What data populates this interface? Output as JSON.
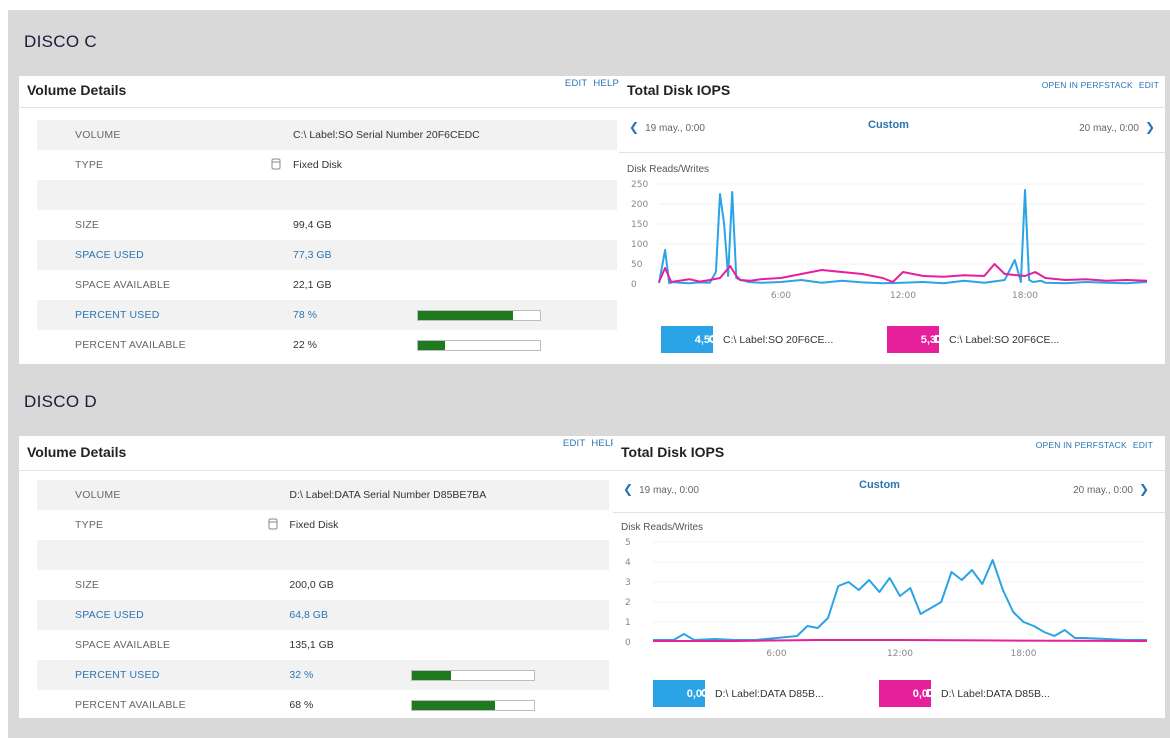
{
  "colors": {
    "reads": "#2aa4e6",
    "writes": "#e6209b",
    "bar": "#1f7a1f",
    "link": "#2b73b3"
  },
  "disks": [
    {
      "section_title": "DISCO C",
      "volume_details": {
        "title": "Volume Details",
        "links": [
          "EDIT",
          "HELP"
        ],
        "rows": [
          {
            "label": "VOLUME",
            "value": "C:\\ Label:SO Serial Number 20F6CEDC"
          },
          {
            "label": "TYPE",
            "icon": "disk-icon",
            "value": "Fixed Disk"
          },
          {
            "label": "",
            "value": ""
          },
          {
            "label": "SIZE",
            "value": "99,4 GB"
          },
          {
            "label": "SPACE USED",
            "value": "77,3 GB"
          },
          {
            "label": "SPACE AVAILABLE",
            "value": "22,1 GB"
          },
          {
            "label": "PERCENT USED",
            "value": "78 %",
            "bar_fraction": 0.78
          },
          {
            "label": "PERCENT AVAILABLE",
            "value": "22 %",
            "bar_fraction": 0.22
          }
        ]
      },
      "iops": {
        "title": "Total Disk IOPS",
        "links": [
          "OPEN IN PERFSTACK",
          "EDIT"
        ],
        "nav_prev": "19 may., 0:00",
        "nav_mode": "Custom",
        "nav_next": "20 may., 0:00",
        "chart_title": "Disk Reads/Writes",
        "legend": [
          {
            "value": "4,5",
            "label": "C:\\ Label:SO 20F6CE...",
            "shape": "circle"
          },
          {
            "value": "5,3",
            "label": "C:\\ Label:SO 20F6CE...",
            "shape": "square"
          }
        ]
      }
    },
    {
      "section_title": "DISCO D",
      "volume_details": {
        "title": "Volume Details",
        "links": [
          "EDIT",
          "HELP"
        ],
        "rows": [
          {
            "label": "VOLUME",
            "value": "D:\\ Label:DATA Serial Number D85BE7BA"
          },
          {
            "label": "TYPE",
            "icon": "disk-icon",
            "value": "Fixed Disk"
          },
          {
            "label": "",
            "value": ""
          },
          {
            "label": "SIZE",
            "value": "200,0 GB"
          },
          {
            "label": "SPACE USED",
            "value": "64,8 GB"
          },
          {
            "label": "SPACE AVAILABLE",
            "value": "135,1 GB"
          },
          {
            "label": "PERCENT USED",
            "value": "32 %",
            "bar_fraction": 0.32
          },
          {
            "label": "PERCENT AVAILABLE",
            "value": "68 %",
            "bar_fraction": 0.68
          }
        ]
      },
      "iops": {
        "title": "Total Disk IOPS",
        "links": [
          "OPEN IN PERFSTACK",
          "EDIT"
        ],
        "nav_prev": "19 may., 0:00",
        "nav_mode": "Custom",
        "nav_next": "20 may., 0:00",
        "chart_title": "Disk Reads/Writes",
        "legend": [
          {
            "value": "0,0",
            "label": "D:\\ Label:DATA D85B...",
            "shape": "circle"
          },
          {
            "value": "0,0",
            "label": "D:\\ Label:DATA D85B...",
            "shape": "square"
          }
        ]
      }
    }
  ],
  "chart_data": [
    {
      "type": "line",
      "title": "Disk Reads/Writes",
      "x_unit": "hour of day",
      "x_ticks": [
        "6:00",
        "12:00",
        "18:00"
      ],
      "x_tick_values": [
        6,
        12,
        18
      ],
      "xlim": [
        0,
        24
      ],
      "ylim": [
        0,
        250
      ],
      "y_ticks": [
        0,
        50,
        100,
        150,
        200,
        250
      ],
      "grid": true,
      "series": [
        {
          "name": "C:\\ Label:SO 20F6CE...",
          "color": "#2aa4e6",
          "x": [
            0,
            0.3,
            0.5,
            0.7,
            1,
            1.5,
            2,
            2.5,
            2.8,
            3,
            3.2,
            3.4,
            3.6,
            3.8,
            4,
            4.2,
            4.4,
            4.7,
            5,
            6,
            7,
            8,
            9,
            10,
            11,
            12,
            13,
            14,
            15,
            16,
            17,
            17.5,
            17.8,
            18,
            18.2,
            18.4,
            18.8,
            19,
            20,
            21,
            22,
            23,
            24
          ],
          "y": [
            2,
            85,
            2,
            5,
            3,
            2,
            4,
            3,
            30,
            225,
            150,
            20,
            230,
            15,
            10,
            8,
            5,
            4,
            3,
            5,
            10,
            3,
            8,
            4,
            2,
            3,
            5,
            2,
            8,
            3,
            10,
            60,
            5,
            235,
            10,
            5,
            8,
            3,
            2,
            5,
            3,
            2,
            5
          ]
        },
        {
          "name": "C:\\ Label:SO 20F6CE...",
          "color": "#e6209b",
          "x": [
            0,
            0.3,
            0.6,
            1,
            1.5,
            2,
            2.5,
            3,
            3.5,
            3.8,
            4,
            4.5,
            5,
            6,
            7,
            8,
            9,
            10,
            11,
            11.5,
            12,
            13,
            14,
            15,
            16,
            16.5,
            17,
            18,
            18.5,
            19,
            20,
            21,
            22,
            23,
            24
          ],
          "y": [
            5,
            40,
            5,
            8,
            12,
            6,
            10,
            15,
            45,
            20,
            10,
            8,
            12,
            15,
            25,
            35,
            30,
            25,
            15,
            5,
            30,
            20,
            18,
            22,
            20,
            50,
            25,
            20,
            30,
            15,
            10,
            12,
            8,
            10,
            8
          ]
        }
      ]
    },
    {
      "type": "line",
      "title": "Disk Reads/Writes",
      "x_unit": "hour of day",
      "x_ticks": [
        "6:00",
        "12:00",
        "18:00"
      ],
      "x_tick_values": [
        6,
        12,
        18
      ],
      "xlim": [
        0,
        24
      ],
      "ylim": [
        0,
        5
      ],
      "y_ticks": [
        0,
        1,
        2,
        3,
        4,
        5
      ],
      "grid": true,
      "series": [
        {
          "name": "D:\\ Label:DATA D85B...",
          "color": "#2aa4e6",
          "x": [
            0,
            1,
            1.5,
            2,
            3,
            4,
            5,
            6,
            7,
            7.5,
            8,
            8.5,
            9,
            9.5,
            10,
            10.5,
            11,
            11.5,
            12,
            12.5,
            13,
            14,
            14.5,
            15,
            15.5,
            16,
            16.5,
            17,
            17.5,
            18,
            18.5,
            19,
            19.5,
            20,
            20.5,
            21,
            22,
            23,
            24
          ],
          "y": [
            0.1,
            0.1,
            0.4,
            0.1,
            0.15,
            0.1,
            0.1,
            0.2,
            0.3,
            0.8,
            0.7,
            1.2,
            2.8,
            3.0,
            2.6,
            3.1,
            2.5,
            3.2,
            2.3,
            2.7,
            1.4,
            2.0,
            3.5,
            3.1,
            3.6,
            2.9,
            4.1,
            2.6,
            1.5,
            1.0,
            0.8,
            0.5,
            0.3,
            0.6,
            0.2,
            0.2,
            0.15,
            0.1,
            0.1
          ]
        },
        {
          "name": "D:\\ Label:DATA D85B...",
          "color": "#e6209b",
          "x": [
            0,
            4,
            8,
            10,
            12,
            16,
            20,
            24
          ],
          "y": [
            0.05,
            0.05,
            0.1,
            0.1,
            0.1,
            0.08,
            0.06,
            0.05
          ]
        }
      ]
    }
  ]
}
